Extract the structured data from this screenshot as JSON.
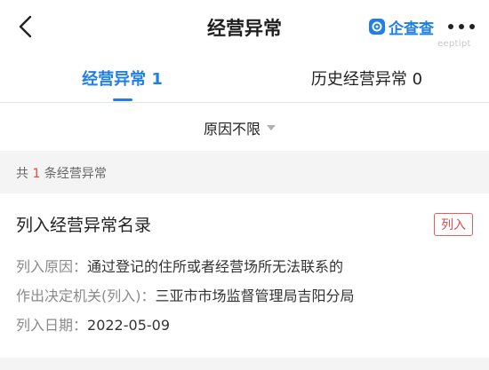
{
  "header": {
    "title": "经营异常",
    "brand": "企查查",
    "watermark": "eeptipt"
  },
  "tabs": [
    {
      "label": "经营异常 1",
      "active": true
    },
    {
      "label": "历史经营异常 0",
      "active": false
    }
  ],
  "filter": {
    "label": "原因不限"
  },
  "summary": {
    "prefix": "共",
    "count": "1",
    "suffix": "条经营异常"
  },
  "record": {
    "title": "列入经营异常名录",
    "badge": "列入",
    "fields": [
      {
        "label": "列入原因：",
        "value": "通过登记的住所或者经营场所无法联系的"
      },
      {
        "label": "作出决定机关(列入)：",
        "value": "三亚市市场监督管理局吉阳分局"
      },
      {
        "label": "列入日期：",
        "value": "2022-05-09"
      }
    ]
  },
  "colors": {
    "accent": "#1f7fe6",
    "alert": "#e14a4a",
    "background_gray": "#f4f4f4"
  }
}
